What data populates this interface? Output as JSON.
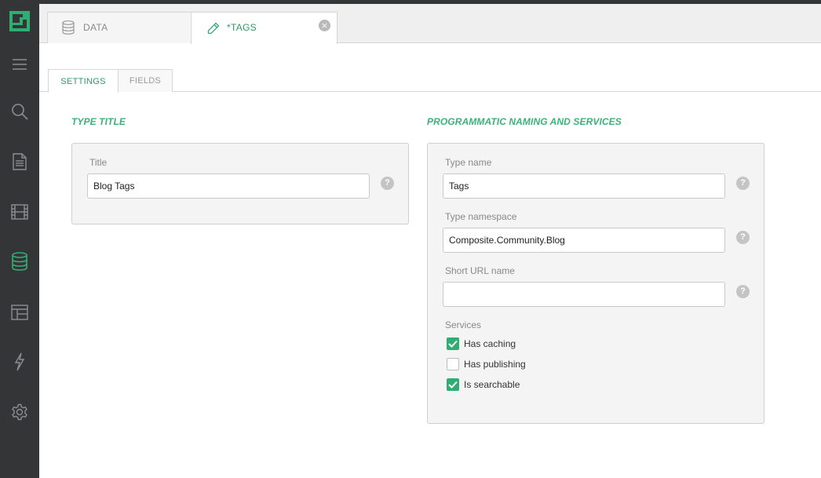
{
  "colors": {
    "accent": "#2fae73",
    "sidebar_bg": "#333536",
    "sidebar_icon": "#8c8f91",
    "sidebar_active_icon": "#2fae73"
  },
  "sidebar": {
    "logo_icon": "composite-logo-icon",
    "items": [
      {
        "icon": "menu-icon",
        "active": false
      },
      {
        "icon": "search-icon",
        "active": false
      },
      {
        "icon": "document-icon",
        "active": false
      },
      {
        "icon": "film-icon",
        "active": false
      },
      {
        "icon": "database-icon",
        "active": true
      },
      {
        "icon": "layout-icon",
        "active": false
      },
      {
        "icon": "lightning-icon",
        "active": false
      },
      {
        "icon": "gear-icon",
        "active": false
      }
    ]
  },
  "doc_tabs": [
    {
      "label": "DATA",
      "icon": "database-icon",
      "active": false
    },
    {
      "label": "*TAGS",
      "icon": "pencil-icon",
      "active": true,
      "close": "×"
    }
  ],
  "sub_tabs": [
    {
      "label": "SETTINGS",
      "active": true
    },
    {
      "label": "FIELDS",
      "active": false
    }
  ],
  "type_title": {
    "heading": "TYPE TITLE",
    "title_label": "Title",
    "title_value": "Blog Tags",
    "help": "?"
  },
  "naming": {
    "heading": "PROGRAMMATIC NAMING AND SERVICES",
    "type_name_label": "Type name",
    "type_name_value": "Tags",
    "namespace_label": "Type namespace",
    "namespace_value": "Composite.Community.Blog",
    "short_url_label": "Short URL name",
    "short_url_value": "",
    "help": "?",
    "services_label": "Services",
    "services": [
      {
        "label": "Has caching",
        "checked": true
      },
      {
        "label": "Has publishing",
        "checked": false
      },
      {
        "label": "Is searchable",
        "checked": true
      }
    ]
  }
}
